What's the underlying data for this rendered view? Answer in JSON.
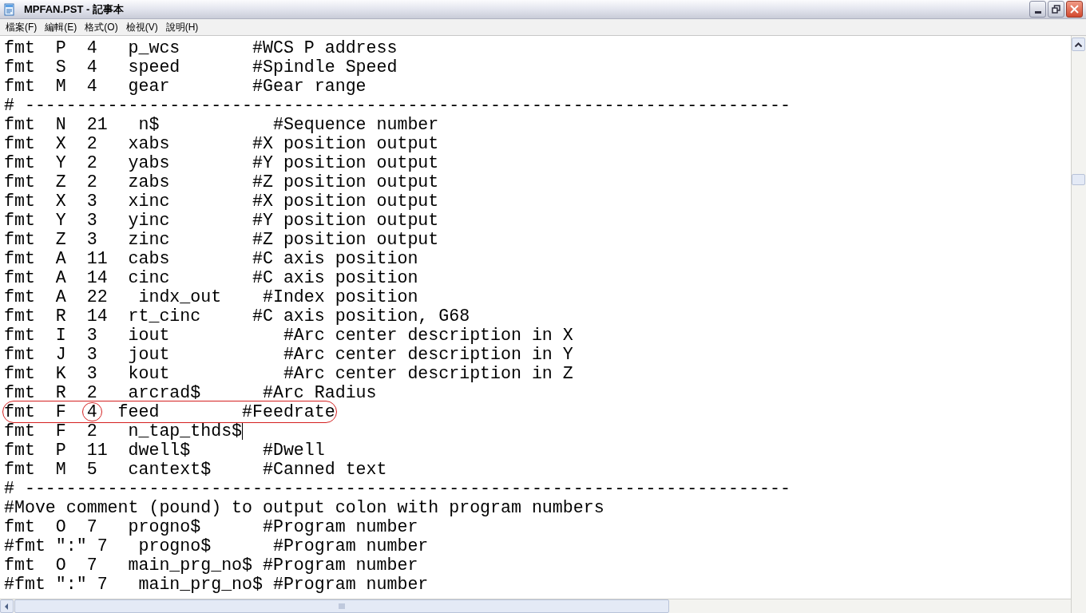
{
  "window": {
    "title": "MPFAN.PST - 記事本"
  },
  "menu": [
    {
      "label": "檔案(F)"
    },
    {
      "label": "編輯(E)"
    },
    {
      "label": "格式(O)"
    },
    {
      "label": "檢視(V)"
    },
    {
      "label": "說明(H)"
    }
  ],
  "editor": {
    "lines": [
      {
        "text": "fmt  P  4   p_wcs       #WCS P address"
      },
      {
        "text": "fmt  S  4   speed       #Spindle Speed"
      },
      {
        "text": "fmt  M  4   gear        #Gear range"
      },
      {
        "text": "# --------------------------------------------------------------------------"
      },
      {
        "text": "fmt  N  21   n$           #Sequence number"
      },
      {
        "text": "fmt  X  2   xabs        #X position output"
      },
      {
        "text": "fmt  Y  2   yabs        #Y position output"
      },
      {
        "text": "fmt  Z  2   zabs        #Z position output"
      },
      {
        "text": "fmt  X  3   xinc        #X position output"
      },
      {
        "text": "fmt  Y  3   yinc        #Y position output"
      },
      {
        "text": "fmt  Z  3   zinc        #Z position output"
      },
      {
        "text": "fmt  A  11  cabs        #C axis position"
      },
      {
        "text": "fmt  A  14  cinc        #C axis position"
      },
      {
        "text": "fmt  A  22   indx_out    #Index position"
      },
      {
        "text": "fmt  R  14  rt_cinc     #C axis position, G68"
      },
      {
        "text": "fmt  I  3   iout           #Arc center description in X"
      },
      {
        "text": "fmt  J  3   jout           #Arc center description in Y"
      },
      {
        "text": "fmt  K  3   kout           #Arc center description in Z"
      },
      {
        "text": "fmt  R  2   arcrad$      #Arc Radius"
      },
      {
        "parts": [
          {
            "text": "fmt  F  ",
            "circled": false
          },
          {
            "text": "4",
            "circled": true
          },
          {
            "text": "  feed        #Feedrate",
            "circled": false
          }
        ],
        "outlined": true
      },
      {
        "text": "fmt  F  2   n_tap_thds$",
        "caret": true
      },
      {
        "text": "fmt  P  11  dwell$       #Dwell"
      },
      {
        "text": "fmt  M  5   cantext$     #Canned text"
      },
      {
        "text": "# --------------------------------------------------------------------------"
      },
      {
        "text": "#Move comment (pound) to output colon with program numbers"
      },
      {
        "text": "fmt  O  7   progno$      #Program number"
      },
      {
        "text": "#fmt \":\" 7   progno$      #Program number"
      },
      {
        "text": "fmt  O  7   main_prg_no$ #Program number"
      },
      {
        "text": "#fmt \":\" 7   main_prg_no$ #Program number"
      }
    ]
  }
}
